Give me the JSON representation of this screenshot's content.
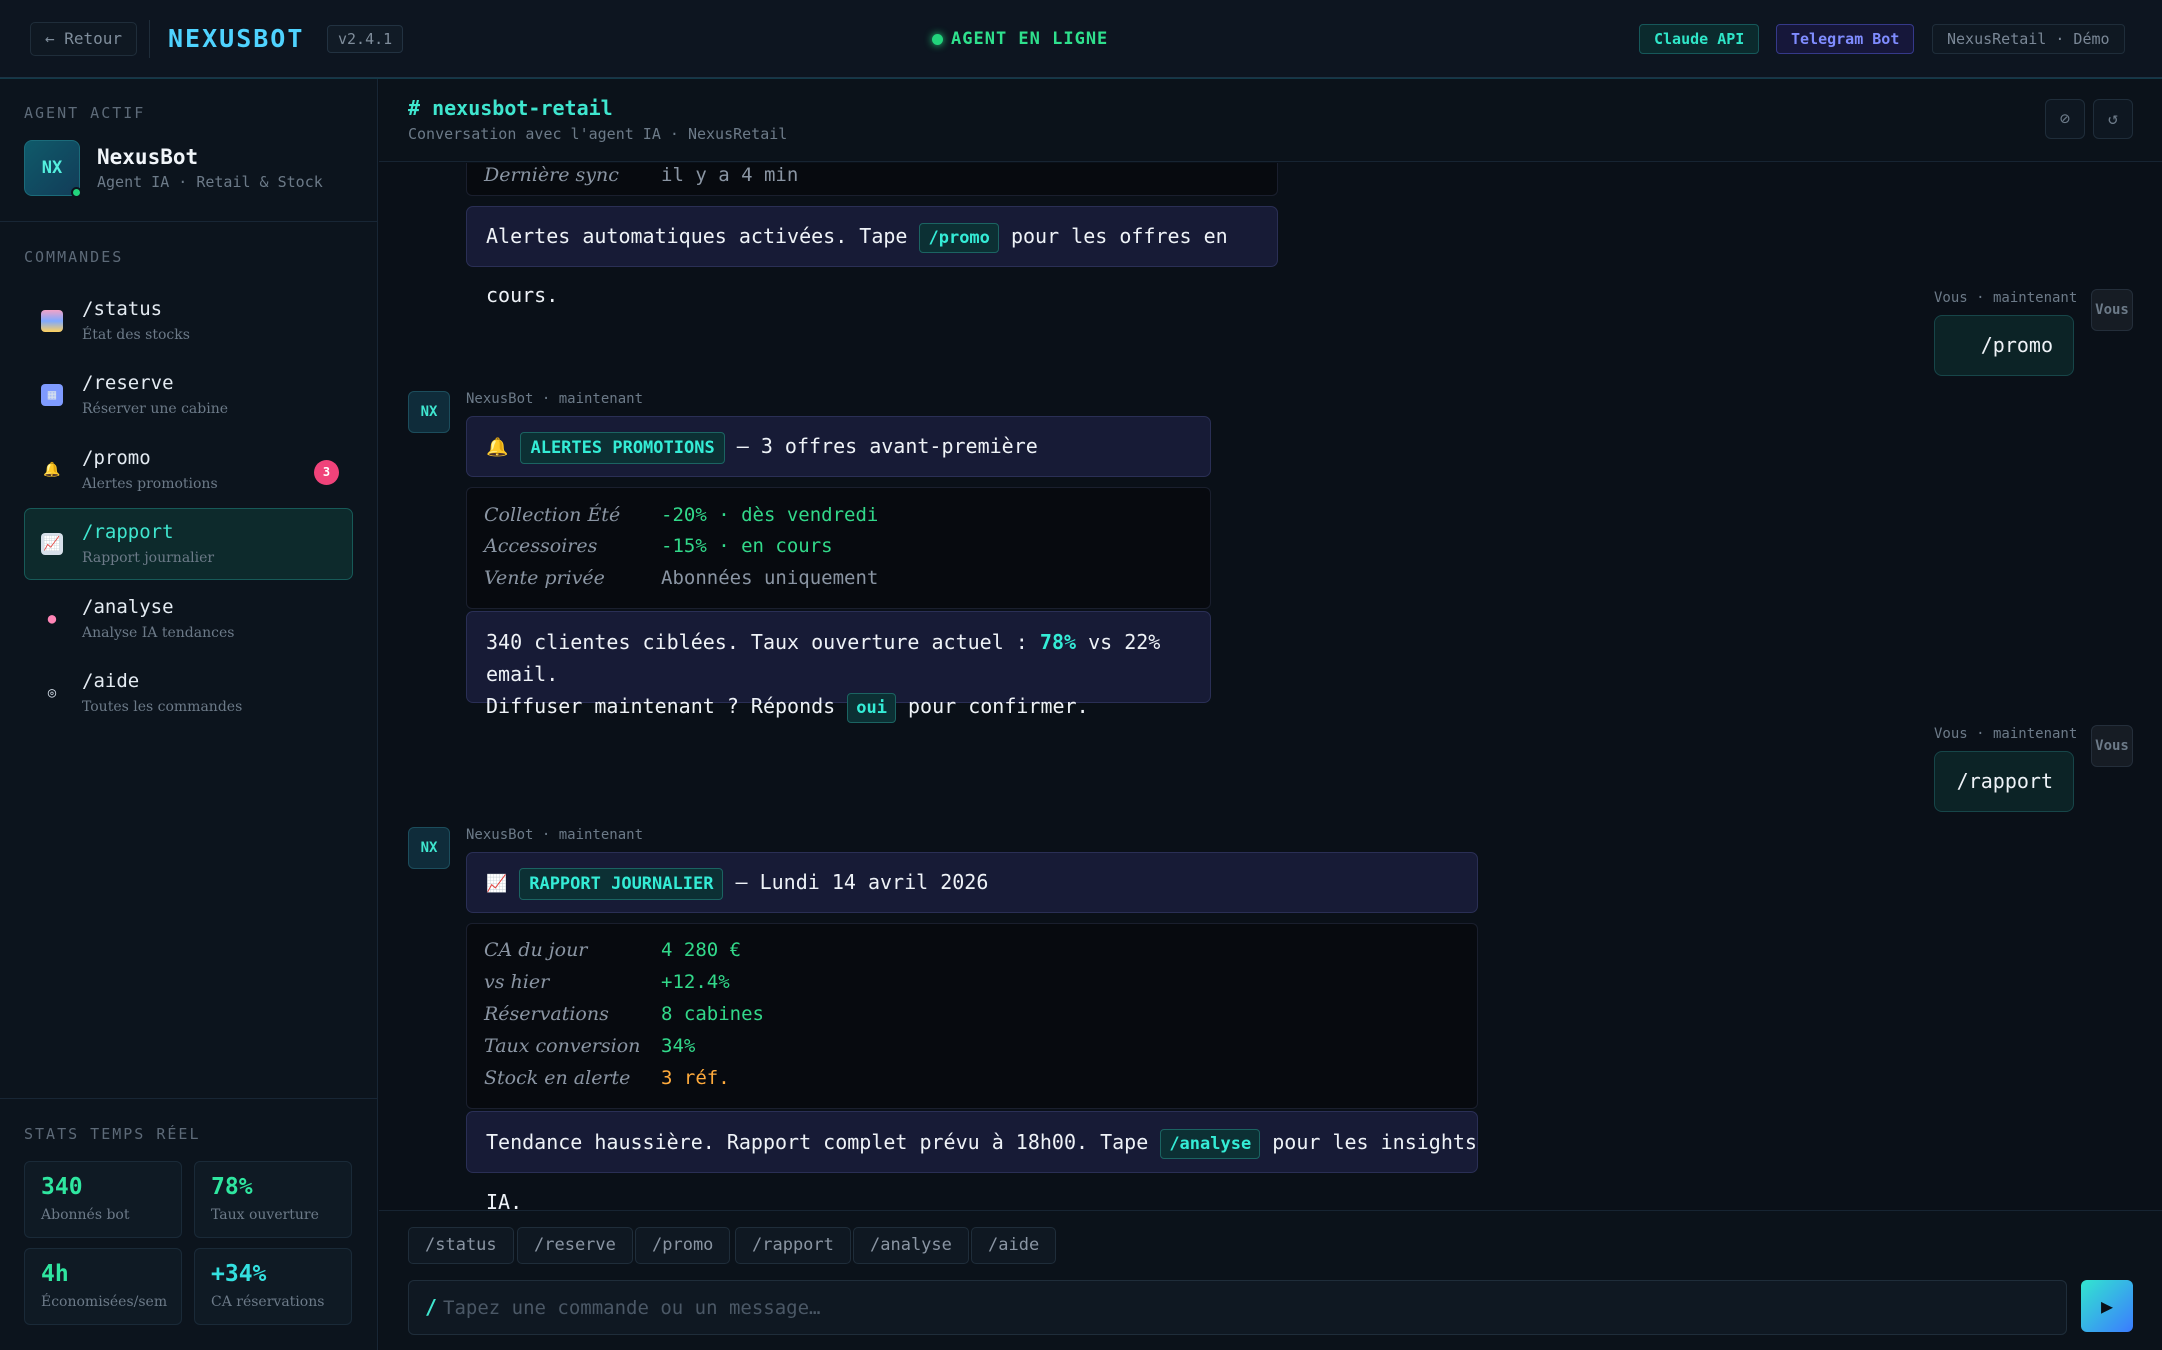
{
  "topbar": {
    "back_label": "← Retour",
    "logo": "NEXUSBOT",
    "version": "v2.4.1",
    "status": "AGENT EN LIGNE",
    "tag_claude": "Claude API",
    "tag_telegram": "Telegram Bot",
    "tag_demo": "NexusRetail · Démo"
  },
  "sidebar": {
    "agent_title": "AGENT ACTIF",
    "agent_initials": "NX",
    "agent_name": "NexusBot",
    "agent_role": "Agent IA · Retail & Stock",
    "commands_title": "COMMANDES",
    "commands": [
      {
        "name": "/status",
        "sub": "État des stocks",
        "icon": "chart-icon"
      },
      {
        "name": "/reserve",
        "sub": "Réserver une cabine",
        "icon": "calendar-icon"
      },
      {
        "name": "/promo",
        "sub": "Alertes promotions",
        "icon": "bell-icon",
        "badge": "3"
      },
      {
        "name": "/rapport",
        "sub": "Rapport journalier",
        "icon": "trend-icon",
        "active": true
      },
      {
        "name": "/analyse",
        "sub": "Analyse IA tendances",
        "icon": "brain-icon"
      },
      {
        "name": "/aide",
        "sub": "Toutes les commandes",
        "icon": "help-icon"
      }
    ],
    "stats_title": "STATS TEMPS RÉEL",
    "stats": [
      {
        "value": "340",
        "label": "Abonnés bot"
      },
      {
        "value": "78%",
        "label": "Taux ouverture"
      },
      {
        "value": "4h",
        "label": "Économisées/sem"
      },
      {
        "value": "+34%",
        "label": "CA réservations"
      }
    ]
  },
  "chat": {
    "channel": "# nexusbot-retail",
    "subtitle": "Conversation avec l'agent IA · NexusRetail",
    "header_buttons": [
      "⊘",
      "↺"
    ],
    "msg0": {
      "row_key": "Dernière sync",
      "row_val": "il y a 4 min",
      "text_before": "Alertes automatiques activées. Tape",
      "code": "/promo",
      "text_after": "pour les offres en cours."
    },
    "user1": {
      "meta": "Vous · maintenant",
      "avatar": "Vous",
      "text": "/promo"
    },
    "bot2": {
      "avatar": "NX",
      "meta": "NexusBot · maintenant",
      "icon": "bell-icon",
      "label": "ALERTES PROMOTIONS",
      "title": "— 3 offres avant-première",
      "rows": [
        {
          "k": "Collection Été",
          "v": "-20% · dès vendredi"
        },
        {
          "k": "Accessoires",
          "v": "-15% · en cours"
        },
        {
          "k": "Vente privée",
          "v": "Abonnées uniquement"
        }
      ],
      "line1_before": "340 clientes ciblées. Taux ouverture actuel :",
      "line1_hl": "78%",
      "line1_after": "vs 22% email.",
      "line2_before": "Diffuser maintenant ? Réponds",
      "line2_code": "oui",
      "line2_after": "pour confirmer."
    },
    "user3": {
      "meta": "Vous · maintenant",
      "avatar": "Vous",
      "text": "/rapport"
    },
    "bot4": {
      "avatar": "NX",
      "meta": "NexusBot · maintenant",
      "icon": "trend-icon",
      "label": "RAPPORT JOURNALIER",
      "title": "— Lundi 14 avril 2026",
      "rows": [
        {
          "k": "CA du jour",
          "v": "4 280 €"
        },
        {
          "k": "vs hier",
          "v": "+12.4%"
        },
        {
          "k": "Réservations",
          "v": "8 cabines"
        },
        {
          "k": "Taux conversion",
          "v": "34%"
        },
        {
          "k": "Stock en alerte",
          "v": "3 réf."
        }
      ],
      "text_before": "Tendance haussière. Rapport complet prévu à 18h00. Tape",
      "code": "/analyse",
      "text_after": "pour les insights IA."
    }
  },
  "composer": {
    "quick": [
      "/status",
      "/reserve",
      "/promo",
      "/rapport",
      "/analyse",
      "/aide"
    ],
    "slash": "/",
    "placeholder": "Tapez une commande ou un message…",
    "send_icon": "▶"
  }
}
